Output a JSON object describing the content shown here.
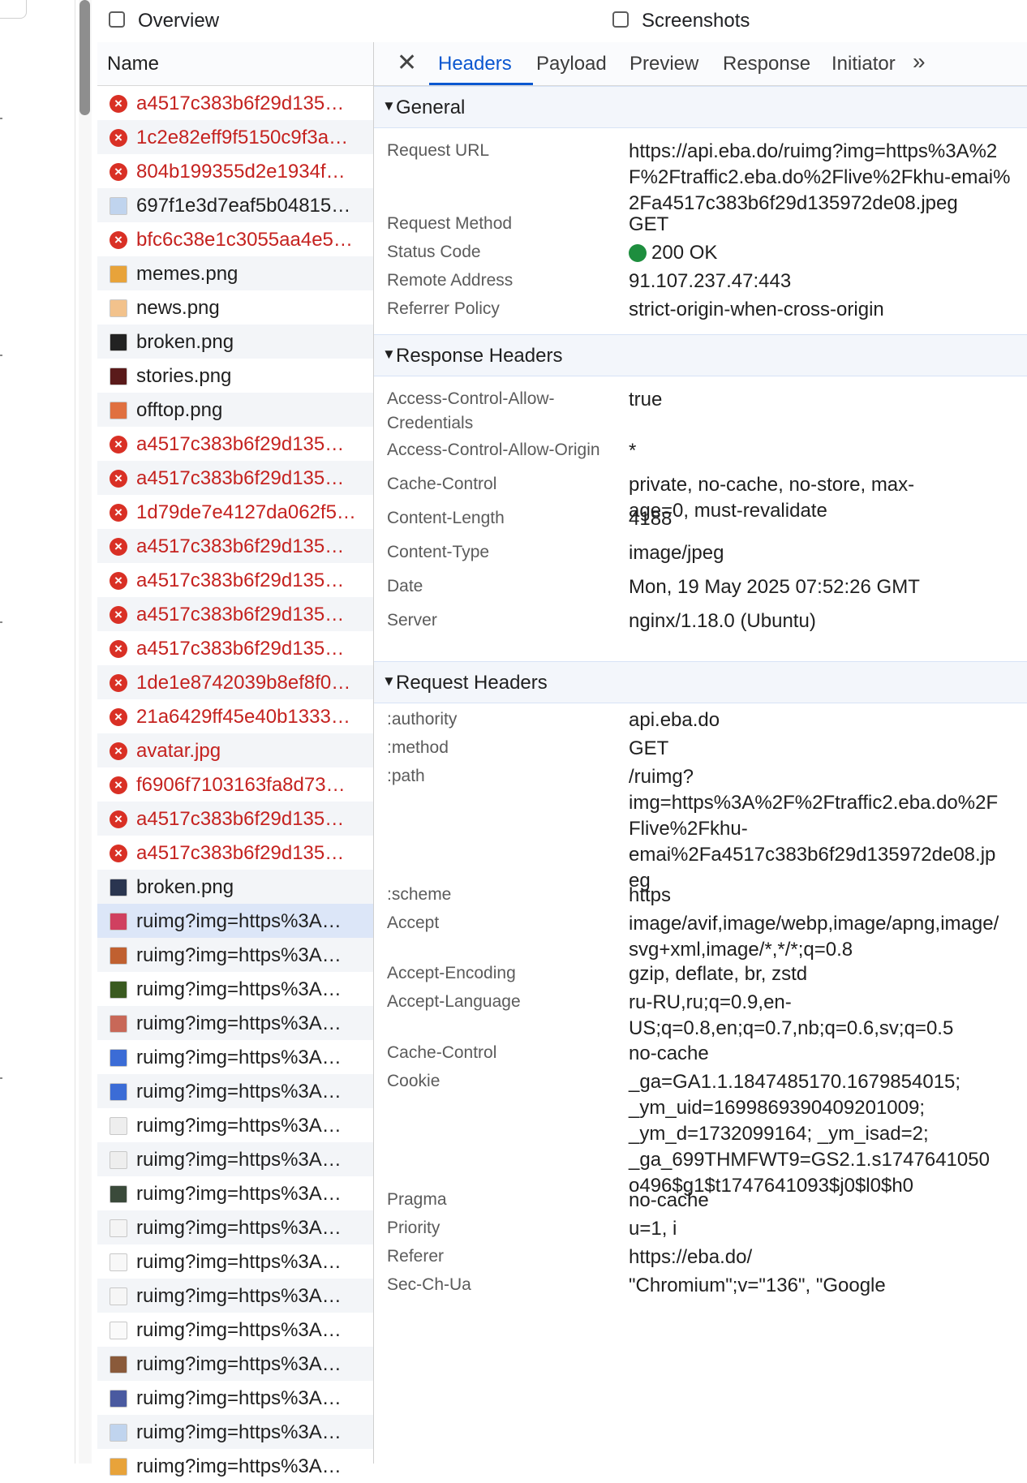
{
  "topbar": {
    "overview_label": "Overview",
    "screenshots_label": "Screenshots"
  },
  "list": {
    "header": "Name",
    "rows": [
      {
        "name": "a4517c383b6f29d135…",
        "kind": "error"
      },
      {
        "name": "1c2e82eff9f5150c9f3a…",
        "kind": "error"
      },
      {
        "name": "804b199355d2e1934f…",
        "kind": "error"
      },
      {
        "name": "697f1e3d7eaf5b04815…",
        "kind": "image"
      },
      {
        "name": "bfc6c38e1c3055aa4e5…",
        "kind": "error"
      },
      {
        "name": "memes.png",
        "kind": "image"
      },
      {
        "name": "news.png",
        "kind": "image"
      },
      {
        "name": "broken.png",
        "kind": "image"
      },
      {
        "name": "stories.png",
        "kind": "image"
      },
      {
        "name": "offtop.png",
        "kind": "image"
      },
      {
        "name": "a4517c383b6f29d135…",
        "kind": "error"
      },
      {
        "name": "a4517c383b6f29d135…",
        "kind": "error"
      },
      {
        "name": "1d79de7e4127da062f5…",
        "kind": "error"
      },
      {
        "name": "a4517c383b6f29d135…",
        "kind": "error"
      },
      {
        "name": "a4517c383b6f29d135…",
        "kind": "error"
      },
      {
        "name": "a4517c383b6f29d135…",
        "kind": "error"
      },
      {
        "name": "a4517c383b6f29d135…",
        "kind": "error"
      },
      {
        "name": "1de1e8742039b8ef8f0…",
        "kind": "error"
      },
      {
        "name": "21a6429ff45e40b1333…",
        "kind": "error"
      },
      {
        "name": "avatar.jpg",
        "kind": "error"
      },
      {
        "name": "f6906f7103163fa8d73…",
        "kind": "error"
      },
      {
        "name": "a4517c383b6f29d135…",
        "kind": "error"
      },
      {
        "name": "a4517c383b6f29d135…",
        "kind": "error"
      },
      {
        "name": "broken.png",
        "kind": "image"
      },
      {
        "name": "ruimg?img=https%3A…",
        "kind": "image",
        "selected": true
      },
      {
        "name": "ruimg?img=https%3A…",
        "kind": "image"
      },
      {
        "name": "ruimg?img=https%3A…",
        "kind": "image"
      },
      {
        "name": "ruimg?img=https%3A…",
        "kind": "image"
      },
      {
        "name": "ruimg?img=https%3A…",
        "kind": "image"
      },
      {
        "name": "ruimg?img=https%3A…",
        "kind": "image"
      },
      {
        "name": "ruimg?img=https%3A…",
        "kind": "image"
      },
      {
        "name": "ruimg?img=https%3A…",
        "kind": "image"
      },
      {
        "name": "ruimg?img=https%3A…",
        "kind": "image"
      },
      {
        "name": "ruimg?img=https%3A…",
        "kind": "image"
      },
      {
        "name": "ruimg?img=https%3A…",
        "kind": "image"
      },
      {
        "name": "ruimg?img=https%3A…",
        "kind": "image"
      },
      {
        "name": "ruimg?img=https%3A…",
        "kind": "image"
      },
      {
        "name": "ruimg?img=https%3A…",
        "kind": "image"
      },
      {
        "name": "ruimg?img=https%3A…",
        "kind": "image"
      },
      {
        "name": "ruimg?img=https%3A…",
        "kind": "image"
      },
      {
        "name": "ruimg?img=https%3A…",
        "kind": "image"
      }
    ]
  },
  "tabs": {
    "headers": "Headers",
    "payload": "Payload",
    "preview": "Preview",
    "response": "Response",
    "initiator": "Initiator"
  },
  "general": {
    "title": "General",
    "rows": [
      {
        "k": "Request URL",
        "v": "https://api.eba.do/ruimg?img=https%3A%2\nF%2Ftraffic2.eba.do%2Flive%2Fkhu-emai%\n2Fa4517c383b6f29d135972de08.jpeg"
      },
      {
        "k": "Request Method",
        "v": "GET"
      },
      {
        "k": "Status Code",
        "v": "200 OK"
      },
      {
        "k": "Remote Address",
        "v": "91.107.237.47:443"
      },
      {
        "k": "Referrer Policy",
        "v": "strict-origin-when-cross-origin"
      }
    ]
  },
  "response_headers": {
    "title": "Response Headers",
    "rows": [
      {
        "k": "Access-Control-Allow-\nCredentials",
        "v": "true"
      },
      {
        "k": "Access-Control-Allow-Origin",
        "v": "*"
      },
      {
        "k": "Cache-Control",
        "v": "private, no-cache, no-store, max-\nage=0, must-revalidate"
      },
      {
        "k": "Content-Length",
        "v": "4188"
      },
      {
        "k": "Content-Type",
        "v": "image/jpeg"
      },
      {
        "k": "Date",
        "v": "Mon, 19 May 2025 07:52:26 GMT"
      },
      {
        "k": "Server",
        "v": "nginx/1.18.0 (Ubuntu)"
      }
    ]
  },
  "request_headers": {
    "title": "Request Headers",
    "rows": [
      {
        "k": ":authority",
        "v": "api.eba.do"
      },
      {
        "k": ":method",
        "v": "GET"
      },
      {
        "k": ":path",
        "v": "/ruimg?\nimg=https%3A%2F%2Ftraffic2.eba.do%2F\nFlive%2Fkhu-\nemai%2Fa4517c383b6f29d135972de08.jp\neg"
      },
      {
        "k": ":scheme",
        "v": "https"
      },
      {
        "k": "Accept",
        "v": "image/avif,image/webp,image/apng,image/\nsvg+xml,image/*,*/*;q=0.8"
      },
      {
        "k": "Accept-Encoding",
        "v": "gzip, deflate, br, zstd"
      },
      {
        "k": "Accept-Language",
        "v": "ru-RU,ru;q=0.9,en-\nUS;q=0.8,en;q=0.7,nb;q=0.6,sv;q=0.5"
      },
      {
        "k": "Cache-Control",
        "v": "no-cache"
      },
      {
        "k": "Cookie",
        "v": "_ga=GA1.1.1847485170.1679854015;\n_ym_uid=1699869390409201009;\n_ym_d=1732099164; _ym_isad=2;\n_ga_699THMFWT9=GS2.1.s1747641050\no496$g1$t1747641093$j0$l0$h0"
      },
      {
        "k": "Pragma",
        "v": "no-cache"
      },
      {
        "k": "Priority",
        "v": "u=1, i"
      },
      {
        "k": "Referer",
        "v": "https://eba.do/"
      },
      {
        "k": "Sec-Ch-Ua",
        "v": "\"Chromium\";v=\"136\", \"Google"
      }
    ]
  },
  "colors": {
    "accent": "#0b57d0",
    "error": "#c5221f",
    "status_ok": "#1e8e3e"
  }
}
